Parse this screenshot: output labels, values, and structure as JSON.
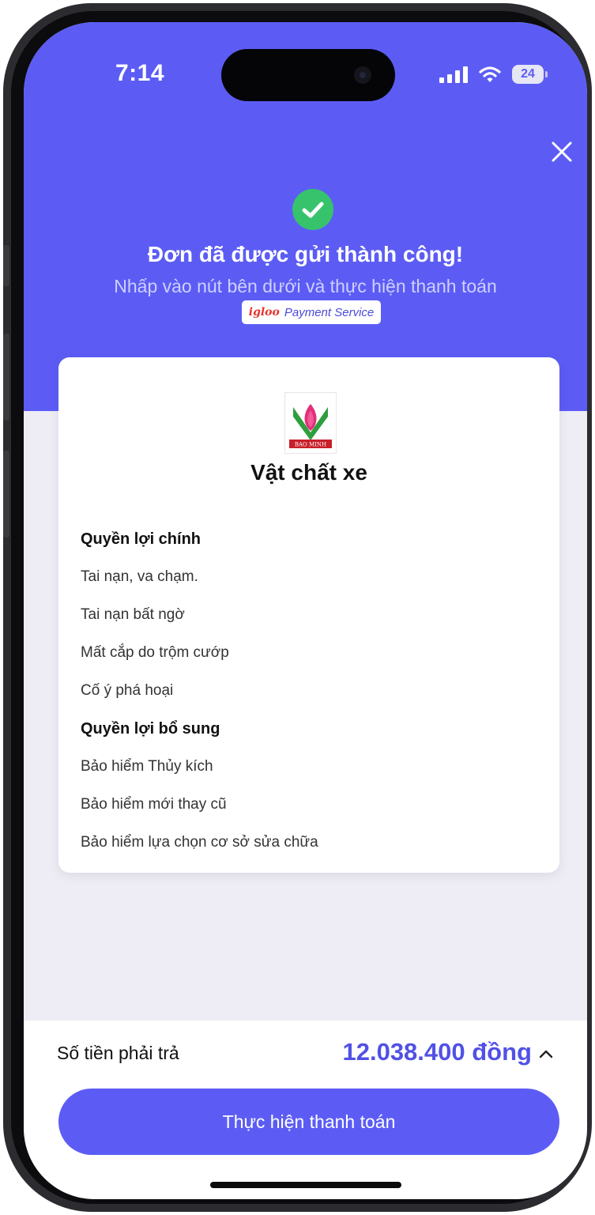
{
  "status_bar": {
    "time": "7:14",
    "battery": "24"
  },
  "header": {
    "title": "Đơn đã được gửi thành công!",
    "subtitle": "Nhấp vào nút bên dưới và thực hiện thanh toán",
    "badge_brand": "igloo",
    "badge_text": "Payment Service"
  },
  "card": {
    "logo_text": "BAO MINH",
    "title": "Vật chất xe",
    "sections": [
      {
        "heading": "Quyền lợi chính",
        "items": [
          "Tai nạn, va chạm.",
          "Tai nạn bất ngờ",
          "Mất cắp do trộm cướp",
          "Cố ý phá hoại"
        ]
      },
      {
        "heading": "Quyền lợi bổ sung",
        "items": [
          "Bảo hiểm Thủy kích",
          "Bảo hiểm mới thay cũ",
          "Bảo hiểm lựa chọn cơ sở sửa chữa"
        ]
      }
    ]
  },
  "footer": {
    "amount_label": "Số tiền phải trả",
    "amount_value": "12.038.400 đồng",
    "pay_label": "Thực hiện thanh toán"
  },
  "colors": {
    "primary": "#5c5cf5",
    "success": "#36c36c",
    "amount": "#5151e6",
    "page_bg": "#eeedf5"
  }
}
